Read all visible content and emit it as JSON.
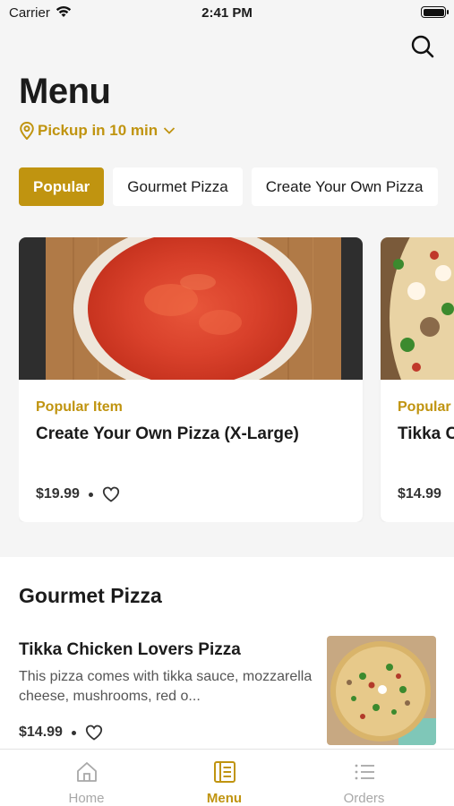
{
  "status_bar": {
    "carrier": "Carrier",
    "time": "2:41 PM"
  },
  "header": {
    "title": "Menu",
    "pickup_label": "Pickup in 10 min"
  },
  "tabs": [
    {
      "label": "Popular",
      "active": true
    },
    {
      "label": "Gourmet Pizza",
      "active": false
    },
    {
      "label": "Create Your Own Pizza",
      "active": false
    }
  ],
  "popular_cards": [
    {
      "tag": "Popular Item",
      "name": "Create Your Own Pizza (X-Large)",
      "price": "$19.99"
    },
    {
      "tag": "Popular Item",
      "name": "Tikka Chicken Lovers Pizza",
      "price": "$14.99"
    }
  ],
  "section": {
    "title": "Gourmet Pizza",
    "items": [
      {
        "name": "Tikka Chicken Lovers Pizza",
        "description": "This pizza comes with tikka sauce, mozzarella cheese, mushrooms, red o...",
        "price": "$14.99"
      }
    ]
  },
  "tab_bar": [
    {
      "label": "Home",
      "icon": "home-icon",
      "active": false
    },
    {
      "label": "Menu",
      "icon": "menu-book-icon",
      "active": true
    },
    {
      "label": "Orders",
      "icon": "list-icon",
      "active": false
    }
  ],
  "colors": {
    "accent": "#c09410",
    "background": "#f5f5f5",
    "inactive": "#a8a8a8"
  }
}
